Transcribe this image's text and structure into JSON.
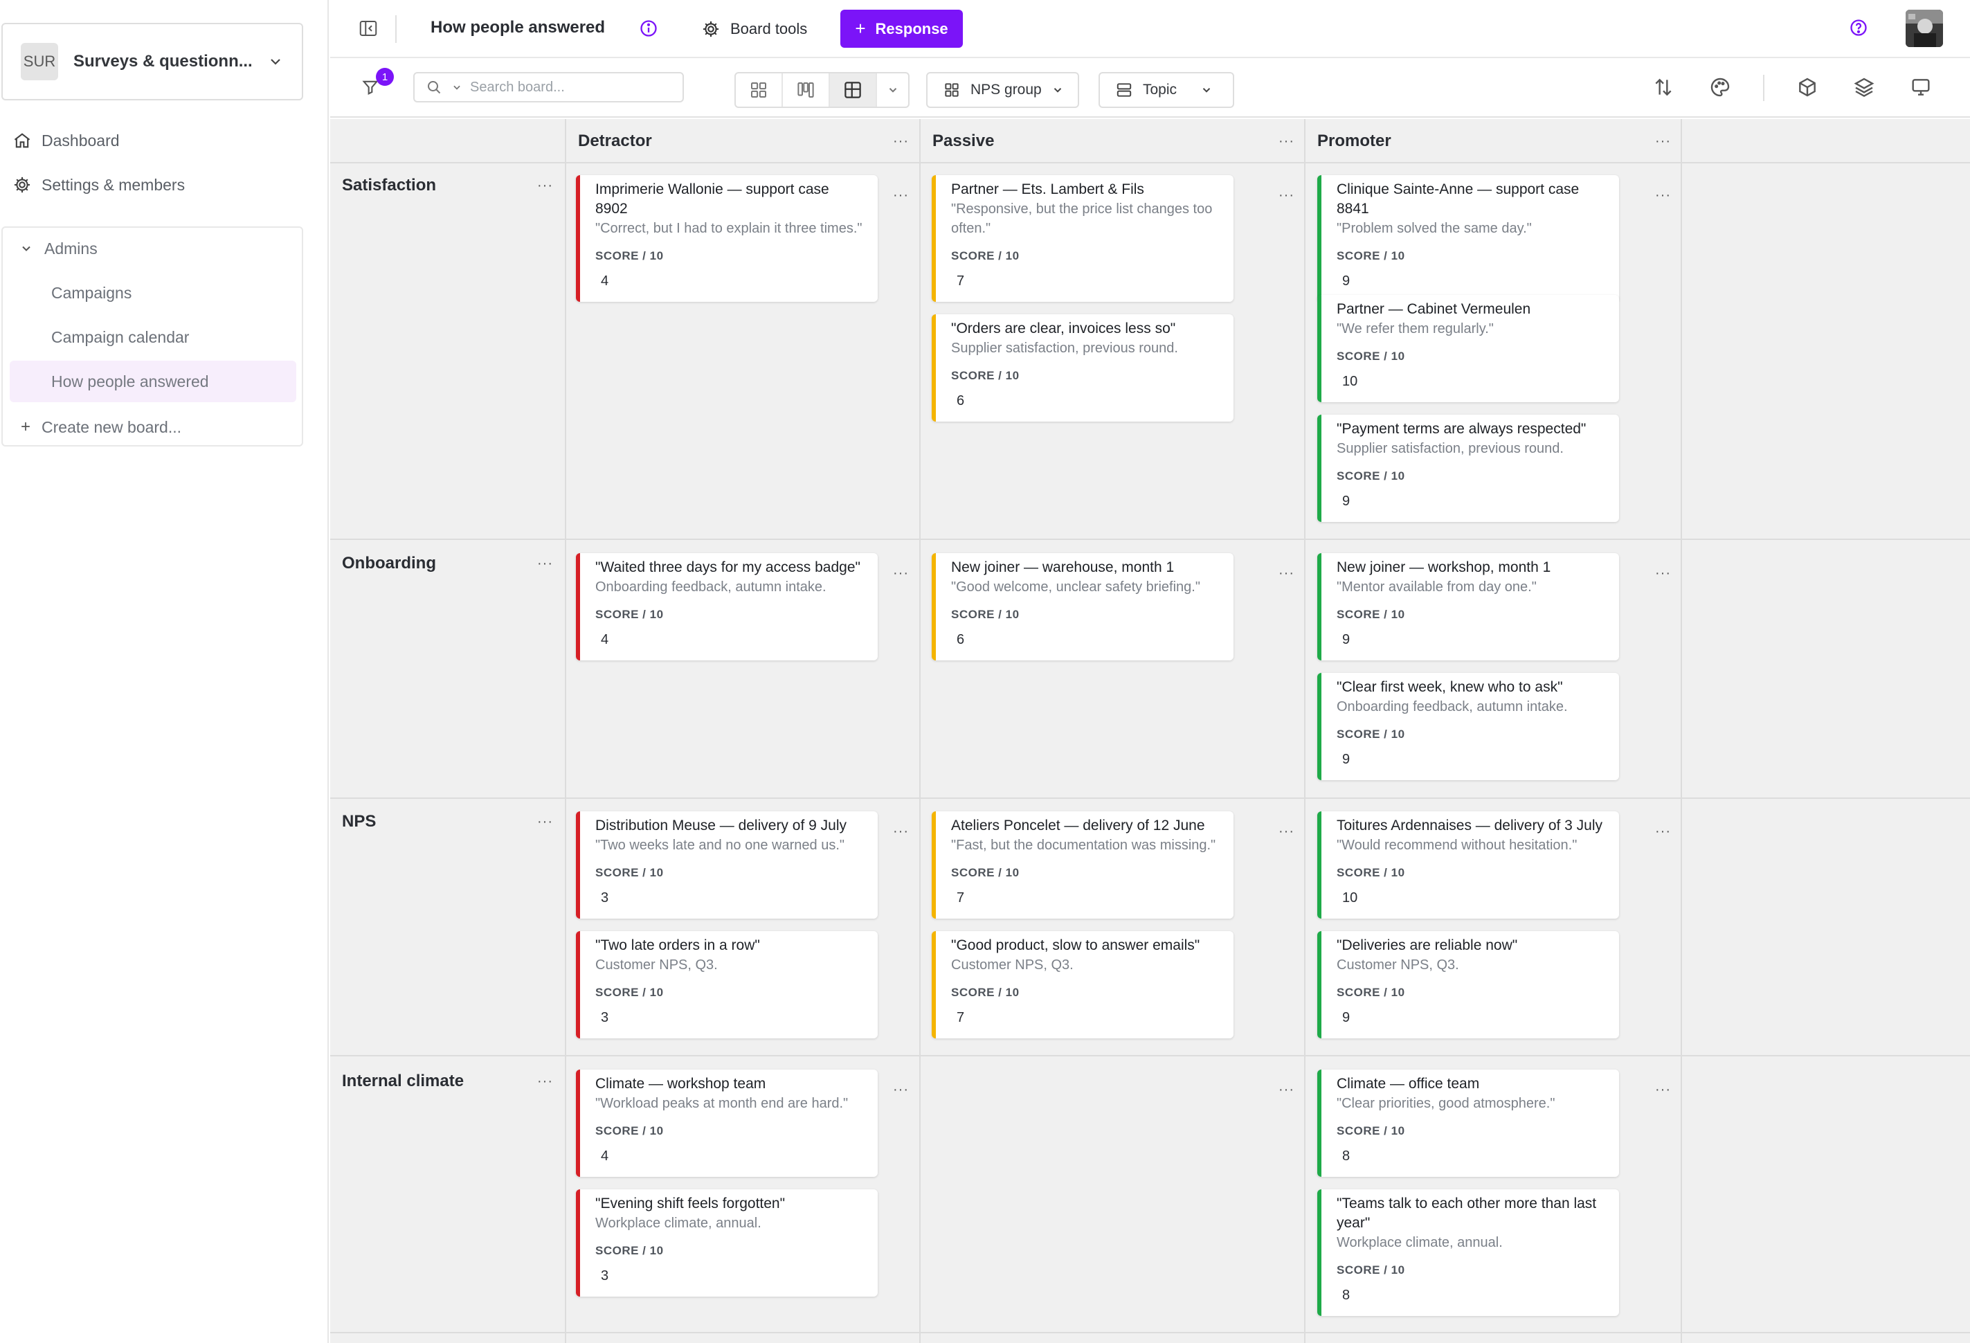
{
  "workspace": {
    "badge": "SUR",
    "name": "Surveys & questionn..."
  },
  "sidebar": {
    "nav": [
      {
        "label": "Dashboard",
        "icon": "home-icon"
      },
      {
        "label": "Settings & members",
        "icon": "gear-icon"
      }
    ],
    "section": {
      "label": "Admins"
    },
    "boards": [
      {
        "label": "Campaigns",
        "active": false
      },
      {
        "label": "Campaign calendar",
        "active": false
      },
      {
        "label": "How people answered",
        "active": true
      }
    ],
    "create": "Create new board..."
  },
  "header": {
    "title": "How people answered",
    "board_tools": "Board tools",
    "response_button": "Response"
  },
  "toolbar": {
    "filter_count": "1",
    "search_placeholder": "Search board...",
    "group_by": "NPS group",
    "rows_by": "Topic"
  },
  "board": {
    "columns": [
      "Detractor",
      "Passive",
      "Promoter"
    ],
    "score_label": "SCORE / 10",
    "rows": [
      {
        "label": "Satisfaction",
        "cells": [
          [
            {
              "title": "Imprimerie Wallonie — support case 8902",
              "subtitle": "\"Correct, but I had to explain it three times.\"",
              "score": "4"
            }
          ],
          [
            {
              "title": "Partner — Ets. Lambert & Fils",
              "subtitle": "\"Responsive, but the price list changes too often.\"",
              "score": "7"
            },
            {
              "title": "\"Orders are clear, invoices less so\"",
              "subtitle": "Supplier satisfaction, previous round.",
              "score": "6"
            }
          ],
          [
            {
              "title": "Clinique Sainte-Anne — support case 8841",
              "subtitle": "\"Problem solved the same day.\"",
              "score": "9"
            },
            {
              "title": "Partner — Cabinet Vermeulen",
              "subtitle": "\"We refer them regularly.\"",
              "score": "10"
            },
            {
              "title": "\"Payment terms are always respected\"",
              "subtitle": "Supplier satisfaction, previous round.",
              "score": "9"
            }
          ]
        ]
      },
      {
        "label": "Onboarding",
        "cells": [
          [
            {
              "title": "\"Waited three days for my access badge\"",
              "subtitle": "Onboarding feedback, autumn intake.",
              "score": "4"
            }
          ],
          [
            {
              "title": "New joiner — warehouse, month 1",
              "subtitle": "\"Good welcome, unclear safety briefing.\"",
              "score": "6"
            }
          ],
          [
            {
              "title": "New joiner — workshop, month 1",
              "subtitle": "\"Mentor available from day one.\"",
              "score": "9"
            },
            {
              "title": "\"Clear first week, knew who to ask\"",
              "subtitle": "Onboarding feedback, autumn intake.",
              "score": "9"
            }
          ]
        ]
      },
      {
        "label": "NPS",
        "cells": [
          [
            {
              "title": "Distribution Meuse — delivery of 9 July",
              "subtitle": "\"Two weeks late and no one warned us.\"",
              "score": "3"
            },
            {
              "title": "\"Two late orders in a row\"",
              "subtitle": "Customer NPS, Q3.",
              "score": "3"
            }
          ],
          [
            {
              "title": "Ateliers Poncelet — delivery of 12 June",
              "subtitle": "\"Fast, but the documentation was missing.\"",
              "score": "7"
            },
            {
              "title": "\"Good product, slow to answer emails\"",
              "subtitle": "Customer NPS, Q3.",
              "score": "7"
            }
          ],
          [
            {
              "title": "Toitures Ardennaises — delivery of 3 July",
              "subtitle": "\"Would recommend without hesitation.\"",
              "score": "10"
            },
            {
              "title": "\"Deliveries are reliable now\"",
              "subtitle": "Customer NPS, Q3.",
              "score": "9"
            }
          ]
        ]
      },
      {
        "label": "Internal climate",
        "cells": [
          [
            {
              "title": "Climate — workshop team",
              "subtitle": "\"Workload peaks at month end are hard.\"",
              "score": "4"
            },
            {
              "title": "\"Evening shift feels forgotten\"",
              "subtitle": "Workplace climate, annual.",
              "score": "3"
            }
          ],
          [],
          [
            {
              "title": "Climate — office team",
              "subtitle": "\"Clear priorities, good atmosphere.\"",
              "score": "8"
            },
            {
              "title": "\"Teams talk to each other more than last year\"",
              "subtitle": "Workplace climate, annual.",
              "score": "8"
            }
          ]
        ]
      }
    ]
  },
  "colors": {
    "accent": "#7b14f8",
    "detractor": "#d61f26",
    "passive": "#f4b400",
    "promoter": "#1eaa48"
  }
}
